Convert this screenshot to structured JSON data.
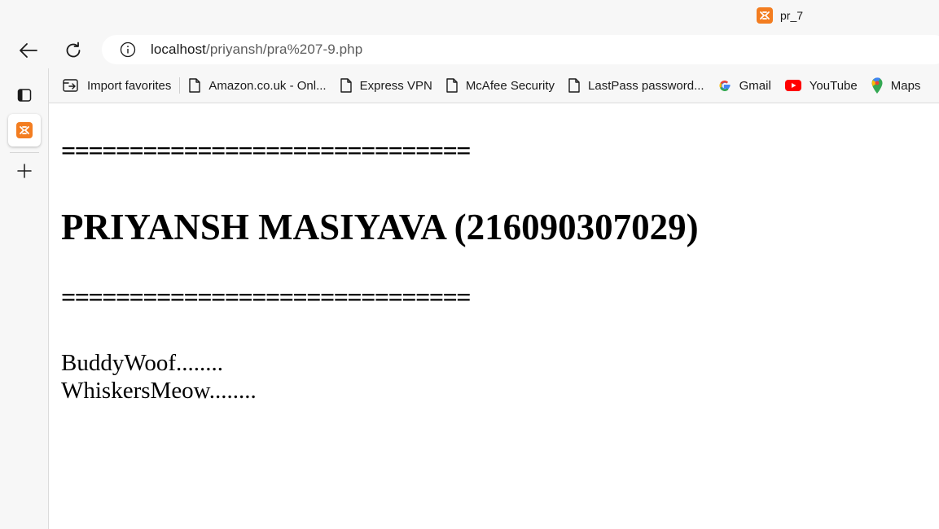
{
  "tab": {
    "title": "pr_7",
    "icon": "xampp-icon"
  },
  "toolbar": {
    "back_icon": "back-arrow-icon",
    "refresh_icon": "refresh-icon",
    "info_icon": "info-icon",
    "url_host": "localhost",
    "url_path": "/priyansh/pra%207-9.php"
  },
  "favorites": [
    {
      "label": "Import favorites",
      "icon": "import-icon"
    },
    {
      "label": "Amazon.co.uk - Onl...",
      "icon": "page-icon"
    },
    {
      "label": "Express VPN",
      "icon": "page-icon"
    },
    {
      "label": "McAfee Security",
      "icon": "page-icon"
    },
    {
      "label": "LastPass password...",
      "icon": "page-icon"
    },
    {
      "label": "Gmail",
      "icon": "google-icon"
    },
    {
      "label": "YouTube",
      "icon": "youtube-icon"
    },
    {
      "label": "Maps",
      "icon": "maps-icon"
    }
  ],
  "sidebar": {
    "items": [
      {
        "icon": "tab-actions-icon"
      },
      {
        "icon": "xampp-icon"
      },
      {
        "icon": "new-tab-plus-icon"
      }
    ]
  },
  "page": {
    "rule_top": "==============================",
    "heading": "PRIYANSH MASIYAVA (216090307029)",
    "rule_bottom": "==============================",
    "lines": [
      "BuddyWoof........",
      "WhiskersMeow........"
    ]
  },
  "colors": {
    "accent_xampp": "#f37d20",
    "youtube_red": "#ff0000",
    "chrome_bg": "#f7f7f7"
  }
}
